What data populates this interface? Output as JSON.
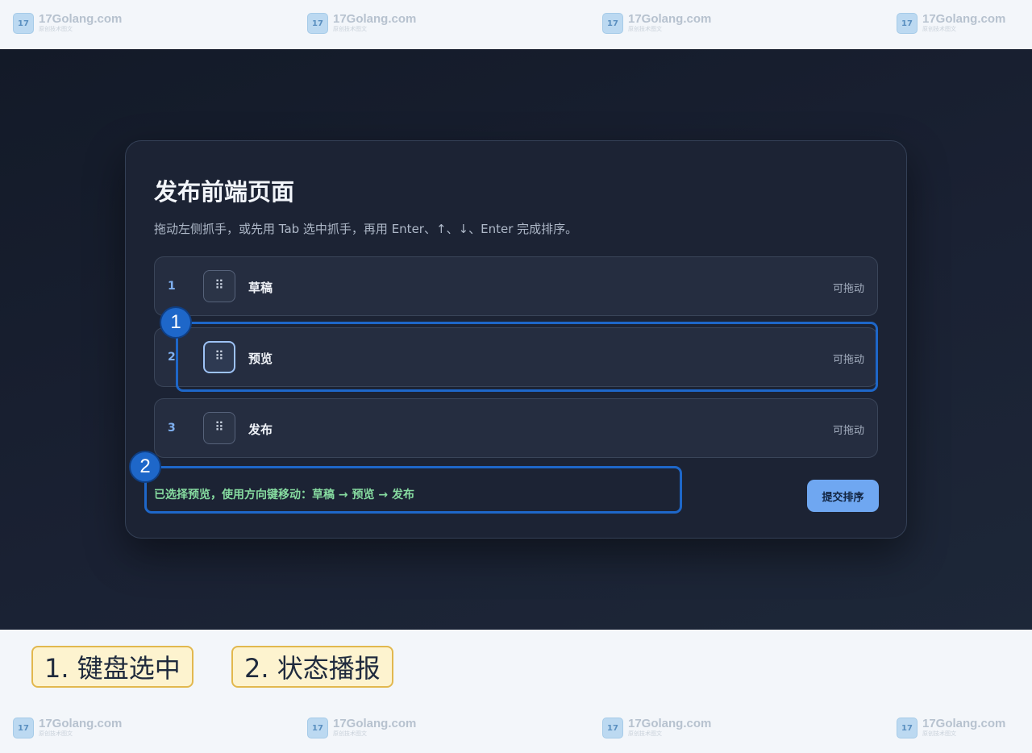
{
  "watermark": {
    "site": "17Golang.com",
    "tagline": "原创技术图文",
    "logo_icon": "17golang-logo-icon"
  },
  "card": {
    "title": "发布前端页面",
    "hint": "拖动左侧抓手，或先用 Tab 选中抓手，再用 Enter、↑、↓、Enter 完成排序。"
  },
  "rows": [
    {
      "index": "1",
      "label": "草稿",
      "status": "可拖动"
    },
    {
      "index": "2",
      "label": "预览",
      "status": "可拖动",
      "focused": true
    },
    {
      "index": "3",
      "label": "发布",
      "status": "可拖动"
    }
  ],
  "handle_glyph": "⠿",
  "live_status": "已选择预览，使用方向键移动：草稿 → 预览 → 发布",
  "submit_label": "提交排序",
  "annotations": [
    {
      "marker": "1",
      "legend": "1. 键盘选中"
    },
    {
      "marker": "2",
      "legend": "2. 状态播报"
    }
  ],
  "colors": {
    "accent": "#6fa7f1",
    "annotation": "#1e67c9",
    "status_text": "#86dba0",
    "legend_fill": "#fdf3cf",
    "legend_border": "#e2b84e"
  }
}
